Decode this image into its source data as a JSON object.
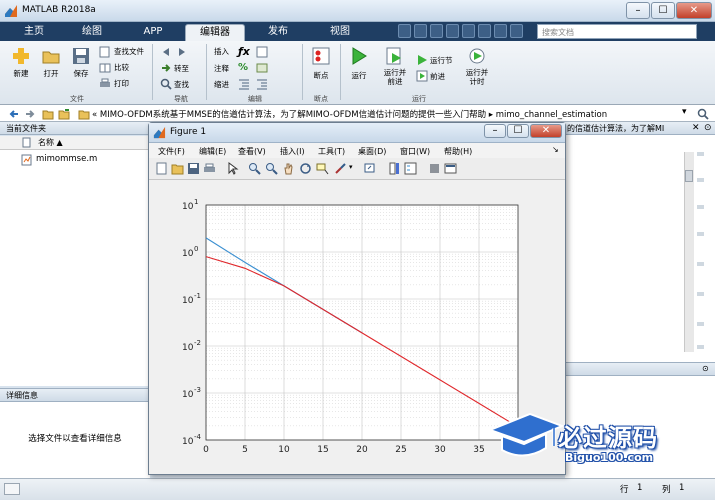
{
  "window": {
    "title": "MATLAB R2018a"
  },
  "ribbon_tabs": [
    "主页",
    "绘图",
    "APP",
    "编辑器",
    "发布",
    "视图"
  ],
  "search": {
    "placeholder": "搜索文档"
  },
  "ribbon": {
    "file_group": {
      "new": "新建",
      "open": "打开",
      "save": "保存",
      "find_files": "查找文件",
      "compare": "比较",
      "print": "打印",
      "label": "文件"
    },
    "nav_group": {
      "goto": "转至",
      "find": "查找",
      "label": "导航"
    },
    "edit_group": {
      "insert": "插入",
      "comment": "注释",
      "indent": "缩进",
      "label": "编辑"
    },
    "breakpoint_group": {
      "breakpoints": "断点",
      "label": "断点"
    },
    "run_group": {
      "run": "运行",
      "run_advance": "运行并\n前进",
      "run_section": "运行节",
      "advance": "前进",
      "run_time": "运行并\n计时",
      "label": "运行"
    }
  },
  "address": {
    "path": "«  MIMO-OFDM系统基于MMSE的信道估计算法，为了解MIMO-OFDM信道估计问题的提供一些入门帮助  ▸  mimo_channel_estimation",
    "right_overflow": "的信道估计算法，为了解MI"
  },
  "current_folder": {
    "title": "当前文件夹",
    "column_name": "名称 ▲",
    "files": [
      "mimommse.m"
    ]
  },
  "details": {
    "title": "详细信息",
    "placeholder": "选择文件以查看详细信息"
  },
  "figure": {
    "title": "Figure 1",
    "menus": [
      "文件(F)",
      "编辑(E)",
      "查看(V)",
      "插入(I)",
      "工具(T)",
      "桌面(D)",
      "窗口(W)",
      "帮助(H)"
    ]
  },
  "status": {
    "row_label": "行",
    "row": "1",
    "col_label": "列",
    "col": "1"
  },
  "watermark": {
    "cn": "必过源码",
    "en": "Biguo100.com"
  },
  "colors": {
    "series1": "#3a8fd1",
    "series2": "#e0282c",
    "tab_bar": "#1f3e63"
  },
  "chart_data": {
    "type": "line",
    "yscale": "log",
    "xlim": [
      0,
      40
    ],
    "ylim": [
      0.0001,
      10
    ],
    "grid": true,
    "xticks": [
      "0",
      "5",
      "10",
      "15",
      "20",
      "25",
      "30",
      "35"
    ],
    "yticks": [
      "10^1",
      "10^0",
      "10^-1",
      "10^-2",
      "10^-3",
      "10^-4"
    ],
    "series": [
      {
        "color": "#3a8fd1",
        "x": [
          0,
          5,
          10,
          15,
          20
        ],
        "y": [
          2.0,
          0.6,
          0.19,
          0.06,
          0.019
        ]
      },
      {
        "color": "#e0282c",
        "x": [
          0,
          5,
          10,
          15,
          20,
          25,
          30,
          35,
          40
        ],
        "y": [
          0.8,
          0.45,
          0.19,
          0.06,
          0.019,
          0.006,
          0.0019,
          0.0006,
          0.00019
        ]
      }
    ]
  }
}
